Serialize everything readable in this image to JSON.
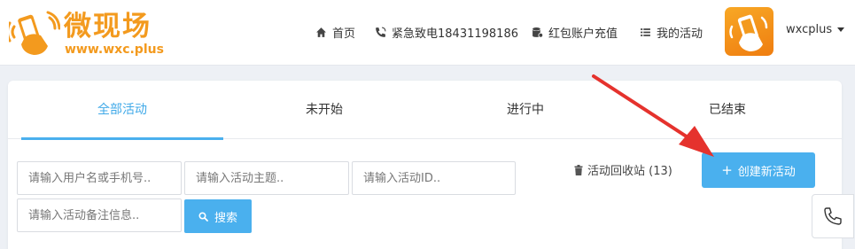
{
  "logo": {
    "title": "微现场",
    "url": "www.wxc.plus"
  },
  "nav": {
    "home": "首页",
    "hotline": "紧急致电18431198186",
    "recharge": "红包账户充值",
    "my_activities": "我的活动"
  },
  "user": {
    "name": "wxcplus"
  },
  "tabs": [
    "全部活动",
    "未开始",
    "进行中",
    "已结束"
  ],
  "active_tab": "全部活动",
  "filters": {
    "username_placeholder": "请输入用户名或手机号..",
    "topic_placeholder": "请输入活动主题..",
    "id_placeholder": "请输入活动ID..",
    "remark_placeholder": "请输入活动备注信息.."
  },
  "search_label": "搜索",
  "recycle_bin": "活动回收站 (13)",
  "create_label": "创建新活动",
  "icons": [
    "home-icon",
    "phone-icon",
    "database-icon",
    "list-icon",
    "trash-icon",
    "search-icon",
    "plus-icon",
    "caret-down-icon"
  ],
  "colors": {
    "accent": "#4ab0ee",
    "brand": "#f39a1e",
    "arrow": "#e5322d"
  }
}
